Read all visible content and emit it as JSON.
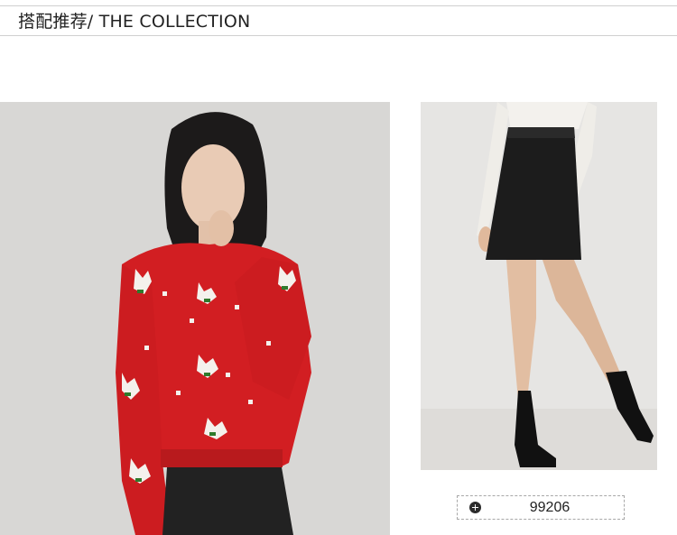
{
  "header": {
    "title": "搭配推荐/ THE COLLECTION"
  },
  "products": [
    {
      "description": "Red knit sweater with white reindeer pattern",
      "code": ""
    },
    {
      "description": "Black leather mini skirt with black sock boots",
      "code": "99206"
    }
  ],
  "icons": {
    "add": "plus-circle-icon"
  },
  "colors": {
    "sweater_red": "#d21e22",
    "divider": "#cfcfcf",
    "text": "#222222"
  }
}
